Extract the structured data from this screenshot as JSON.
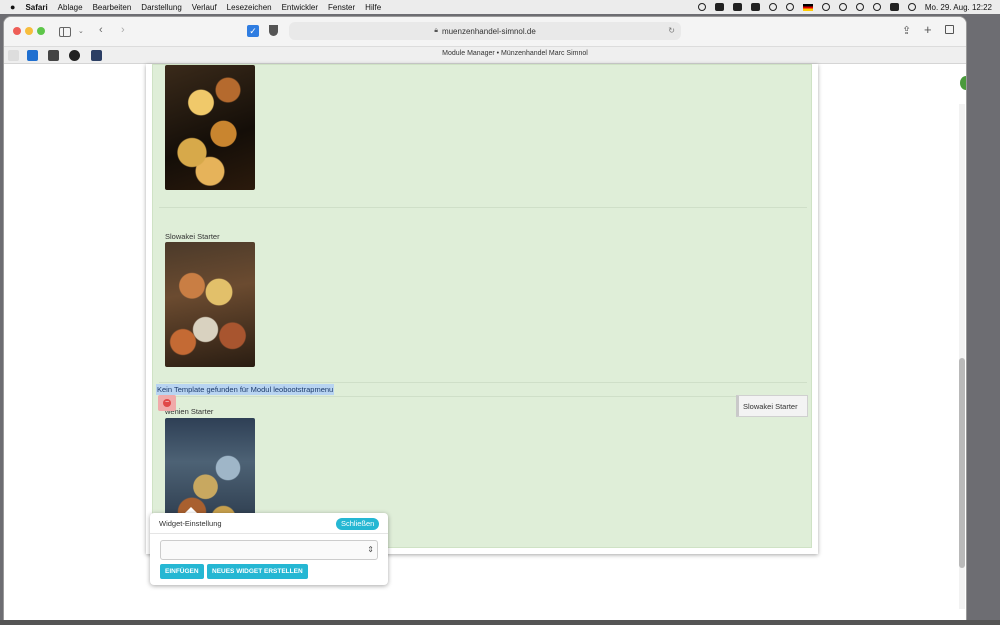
{
  "menubar": {
    "app": "Safari",
    "items": [
      "Ablage",
      "Bearbeiten",
      "Darstellung",
      "Verlauf",
      "Lesezeichen",
      "Entwickler",
      "Fenster",
      "Hilfe"
    ],
    "clock": "Mo. 29. Aug. 12:22"
  },
  "browser": {
    "url": "muenzenhandel-simnol.de",
    "tab_title": "Module Manager • Münzenhandel Marc Simnol"
  },
  "page": {
    "item1_label": "Slowakei Starter",
    "error_message": "Kein Template gefunden für Modul leobootstrapmenu",
    "item2_label": "wenien Starter",
    "chip_label": "Slowakei Starter"
  },
  "widget": {
    "title": "Widget-Einstellung",
    "close_label": "Schließen",
    "insert_label": "EINFÜGEN",
    "new_widget_label": "NEUES WIDGET ERSTELLEN"
  }
}
